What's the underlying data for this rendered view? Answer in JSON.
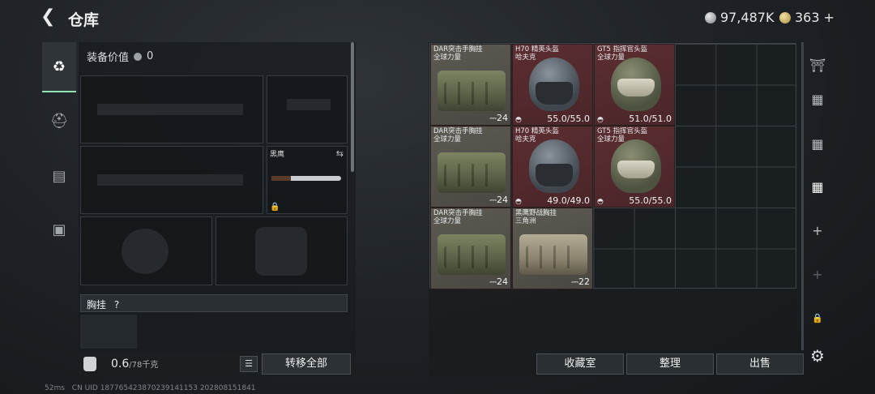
{
  "header": {
    "back_icon": "chevron-left-icon",
    "title": "仓库",
    "currency_a": "97,487K",
    "currency_b": "363",
    "add_symbol": "+"
  },
  "loadout": {
    "value_label": "装备价值",
    "value": "0",
    "knife_label": "黑鹰",
    "rig_label": "胸挂",
    "rig_help": "?",
    "weight": "0.6",
    "weight_max": "/78千克",
    "transfer_all": "转移全部"
  },
  "storage": {
    "items": [
      {
        "name1": "DAR突击手胸挂",
        "name2": "全球力量",
        "count": "24",
        "kind": "bag"
      },
      {
        "name1": "H70 精英头盔",
        "name2": "哈夫克",
        "count": "",
        "durability": "55.0/55.0",
        "kind": "helmet"
      },
      {
        "name1": "GT5 指挥官头盔",
        "name2": "全球力量",
        "count": "",
        "durability": "51.0/51.0",
        "kind": "helmet-olive"
      },
      {
        "name1": "DAR突击手胸挂",
        "name2": "全球力量",
        "count": "24",
        "kind": "bag"
      },
      {
        "name1": "H70 精英头盔",
        "name2": "哈夫克",
        "count": "",
        "durability": "49.0/49.0",
        "kind": "helmet"
      },
      {
        "name1": "GT5 指挥官头盔",
        "name2": "全球力量",
        "count": "",
        "durability": "55.0/55.0",
        "kind": "helmet-olive"
      },
      {
        "name1": "DAR突击手胸挂",
        "name2": "全球力量",
        "count": "24",
        "kind": "bag"
      },
      {
        "name1": "黑鹰野战胸挂",
        "name2": "三角洲",
        "count": "22",
        "kind": "bag-tan"
      }
    ]
  },
  "actions": {
    "collection": "收藏室",
    "organize": "整理",
    "sell": "出售"
  },
  "footer": {
    "ping": "52ms",
    "uid": "CN UID 1877654238702391411​53 202808151841"
  }
}
